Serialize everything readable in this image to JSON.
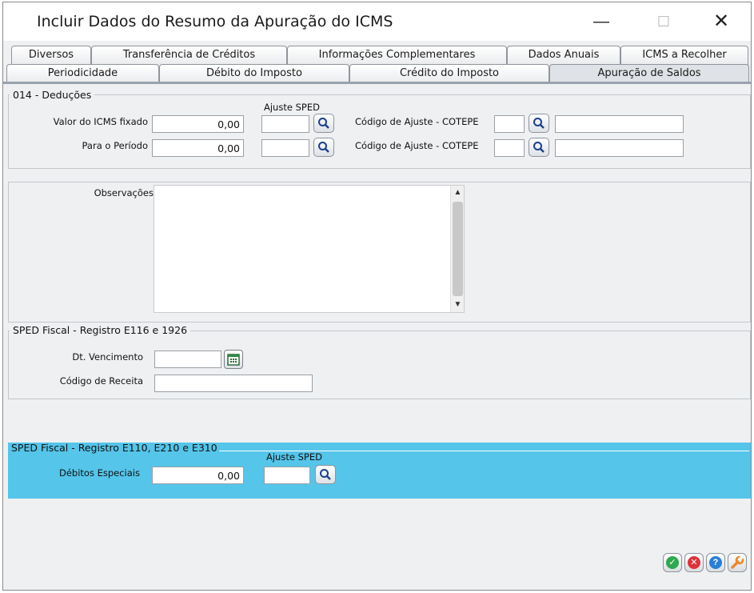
{
  "window": {
    "title": "Incluir Dados do Resumo da Apuração do ICMS",
    "controls": {
      "minimize": "—",
      "maximize": "☐",
      "close": "✕"
    }
  },
  "tabs": {
    "row1": [
      "Diversos",
      "Transferência de Créditos",
      "Informações Complementares",
      "Dados Anuais",
      "ICMS a Recolher"
    ],
    "row2": [
      "Periodicidade",
      "Débito do Imposto",
      "Crédito do Imposto",
      "Apuração de Saldos"
    ],
    "active": "Apuração de Saldos"
  },
  "deducoes": {
    "title": "014 - Deduções",
    "ajuste_header": "Ajuste SPED",
    "rows": [
      {
        "label": "Valor do ICMS fixado",
        "value": "0,00",
        "ajuste": "",
        "cotepe_label": "Código de Ajuste - COTEPE",
        "cotepe_code": "",
        "cotepe_desc": ""
      },
      {
        "label": "Para o Período",
        "value": "0,00",
        "ajuste": "",
        "cotepe_label": "Código de Ajuste - COTEPE",
        "cotepe_code": "",
        "cotepe_desc": ""
      }
    ]
  },
  "observacoes": {
    "label": "Observações",
    "value": ""
  },
  "sped_e116": {
    "title": "SPED Fiscal - Registro E116 e 1926",
    "vencimento_label": "Dt. Vencimento",
    "vencimento_value": "",
    "receita_label": "Código de Receita",
    "receita_value": ""
  },
  "sped_e110": {
    "title": "SPED Fiscal - Registro E110, E210 e E310",
    "ajuste_header": "Ajuste SPED",
    "debitos_label": "Débitos Especiais",
    "debitos_value": "0,00",
    "ajuste_value": ""
  },
  "actions": [
    {
      "name": "confirm",
      "icon": "check-icon",
      "color": "#2fa84f"
    },
    {
      "name": "cancel",
      "icon": "cancel-icon",
      "color": "#e0323a"
    },
    {
      "name": "help",
      "icon": "help-icon",
      "color": "#2b7fd4"
    },
    {
      "name": "tools",
      "icon": "wrench-icon",
      "color": "#e8892b"
    }
  ],
  "colors": {
    "highlight_section": "#55c5ea",
    "panel": "#eef0f2"
  }
}
